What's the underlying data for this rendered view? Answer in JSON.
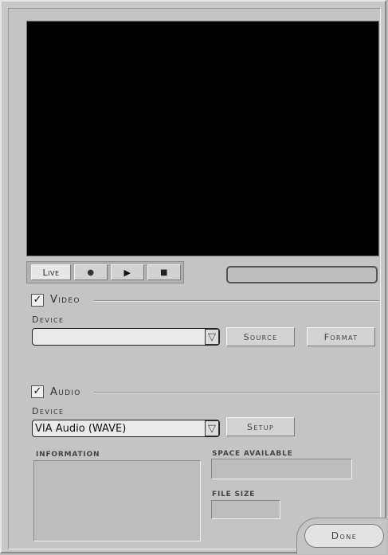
{
  "transport": {
    "live_label": "Live",
    "record_glyph": "●",
    "play_glyph": "▶",
    "stop_glyph": "■",
    "record_icon": "record-icon",
    "play_icon": "play-icon",
    "stop_icon": "stop-icon"
  },
  "status_field": {
    "value": ""
  },
  "video": {
    "checkbox_checked": true,
    "check_glyph": "✓",
    "title": "Video",
    "device_label": "Device",
    "device_value": "",
    "source_label": "Source",
    "format_label": "Format"
  },
  "audio": {
    "checkbox_checked": true,
    "check_glyph": "✓",
    "title": "Audio",
    "device_label": "Device",
    "device_value": "VIA Audio (WAVE)",
    "setup_label": "Setup"
  },
  "combo_arrow_glyph": "▽",
  "info": {
    "information_label": "INFORMATION",
    "information_value": "",
    "space_available_label": "SPACE AVAILABLE",
    "space_available_value": "",
    "file_size_label": "FILE SIZE",
    "file_size_value": ""
  },
  "done_label": "Done",
  "colors": {
    "panel": "#c4c4c4",
    "preview_bg": "#000000",
    "text": "#333333"
  }
}
